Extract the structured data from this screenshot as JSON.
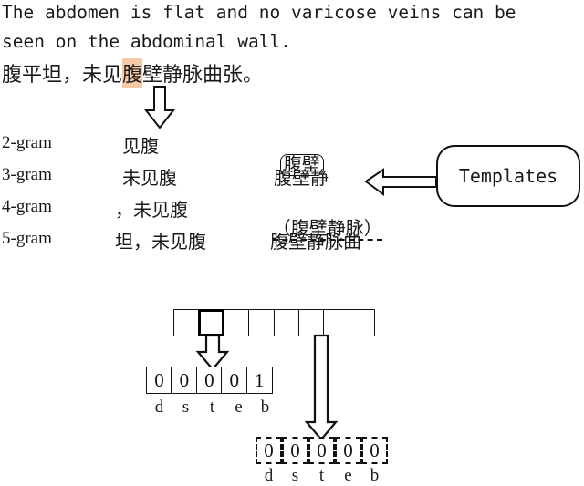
{
  "sentence": {
    "english_line_1": "The abdomen is flat and no varicose veins can be",
    "english_line_2": "seen on the abdominal wall.",
    "chinese_prefix": "腹平坦，未见",
    "chinese_highlighted": "腹",
    "chinese_suffix": "壁静脉曲张。",
    "highlight_color": "#F8C9A6"
  },
  "ngrams": {
    "rows": [
      {
        "label": "2-gram",
        "left": "见腹",
        "right": "腹壁",
        "right_style": "boxed"
      },
      {
        "label": "3-gram",
        "left": "未见腹",
        "right": "腹壁静",
        "right_style": "plain"
      },
      {
        "label": "4-gram",
        "left": "，未见腹",
        "right": "（腹壁静脉）",
        "right_style": "dashed-underline"
      },
      {
        "label": "5-gram",
        "left": "坦，未见腹",
        "right": "腹壁静脉曲",
        "right_style": "plain"
      }
    ]
  },
  "templates": {
    "label": "Templates"
  },
  "bottom": {
    "top_strip": {
      "cells": [
        "",
        "",
        "",
        "",
        "",
        "",
        "",
        ""
      ],
      "active_index": 1,
      "source_index_for_dashed": 5
    },
    "solid_strip": {
      "values": [
        "0",
        "0",
        "0",
        "0",
        "1"
      ],
      "labels": [
        "d",
        "s",
        "t",
        "e",
        "b"
      ]
    },
    "dashed_strip": {
      "values": [
        "0",
        "0",
        "0",
        "0",
        "0"
      ],
      "labels": [
        "d",
        "s",
        "t",
        "e",
        "b"
      ]
    }
  },
  "arrows": {
    "sentence_to_ngram": "down-arrow",
    "templates_to_ngram": "left-arrow",
    "cell_to_solid": "down-arrow",
    "cell_to_dashed": "long-down-arrow"
  }
}
